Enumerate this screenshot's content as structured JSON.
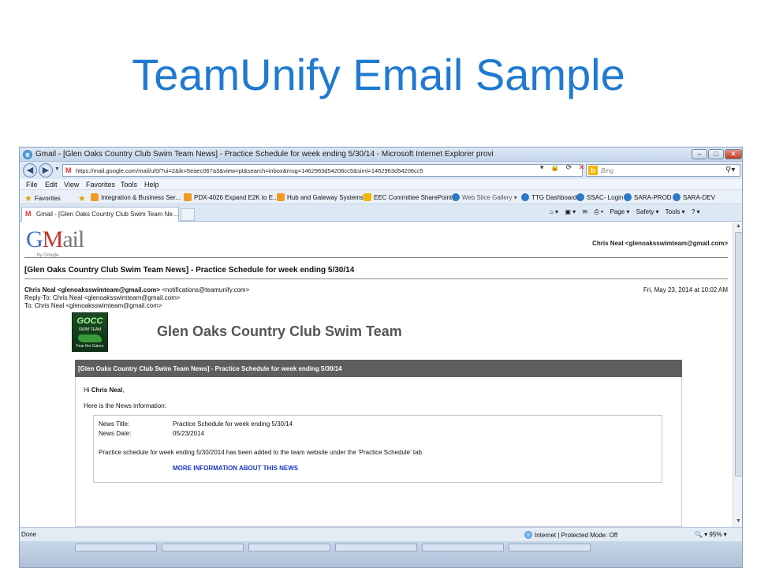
{
  "slide": {
    "title": "TeamUnify Email Sample"
  },
  "window": {
    "title": "Gmail - [Glen Oaks Country Club Swim Team News] - Practice Schedule for week ending 5/30/14 - Microsoft Internet Explorer provi",
    "controls": {
      "minimize": "–",
      "maximize": "□",
      "close": "✕"
    }
  },
  "address": {
    "url": "https://mail.google.com/mail/u/0/?ui=2&ik=5eaec067a3&view=pt&search=inbox&msg=1462963d54206cc5&siml=1462963d54206cc5",
    "search_placeholder": "Bing"
  },
  "menu": [
    "File",
    "Edit",
    "View",
    "Favorites",
    "Tools",
    "Help"
  ],
  "favorites": {
    "label": "Favorites",
    "items": [
      "Integration & Business Ser...",
      "PDX-4026 Expand E2K to E...",
      "Hub and Gateway Systems",
      "EEC Committee SharePoint",
      "Web Slice Gallery ▾",
      "TTG Dashboard",
      "SSAC- Login",
      "SARA-PROD",
      "SARA-DEV"
    ]
  },
  "tab": {
    "label": "Gmail - [Glen Oaks Country Club Swim Team Ne..."
  },
  "commandbar": [
    "⌂ ▾",
    "▣ ▾",
    "✉",
    "⎙ ▾",
    "Page ▾",
    "Safety ▾",
    "Tools ▾",
    "? ▾"
  ],
  "gmail": {
    "logo": "Gmail",
    "by_google": "by Google",
    "user": "Chris Neal <glenoaksswimteam@gmail.com>",
    "subject": "[Glen Oaks Country Club Swim Team News] - Practice Schedule for week ending 5/30/14",
    "from_name": "Chris Neal <glenoaksswimteam@gmail.com>",
    "from_via": "<notifications@teamunify.com>",
    "reply_to": "Reply-To: Chris Neal <glenoaksswimteam@gmail.com>",
    "to": "To: Chris Neal <glenoaksswimteam@gmail.com>",
    "date": "Fri, May 23, 2014 at 10:02 AM"
  },
  "email": {
    "club_logo_text": "GOCC",
    "club_logo_sub": "SWIM TEAM",
    "club_logo_tag": "Fear the Gators",
    "club_name": "Glen Oaks Country Club Swim Team",
    "header_bar": "[Glen Oaks Country Club Swim Team News] - Practice Schedule for week ending 5/30/14",
    "greeting_prefix": "Hi ",
    "greeting_name": "Chris Neal",
    "greeting_suffix": ",",
    "intro": "Here is the News information:",
    "news_title_label": "News Title:",
    "news_title": "Practice Schedule for week ending 5/30/14",
    "news_date_label": "News Date:",
    "news_date": "05/23/2014",
    "description": "Practice schedule for week ending 5/30/2014 has been added to the team website under the 'Practice Schedule' tab.",
    "more_link": "MORE INFORMATION ABOUT THIS NEWS"
  },
  "status": {
    "left": "Done",
    "zone": "Internet | Protected Mode: Off",
    "zoom": "🔍 ▾ 95% ▾"
  }
}
